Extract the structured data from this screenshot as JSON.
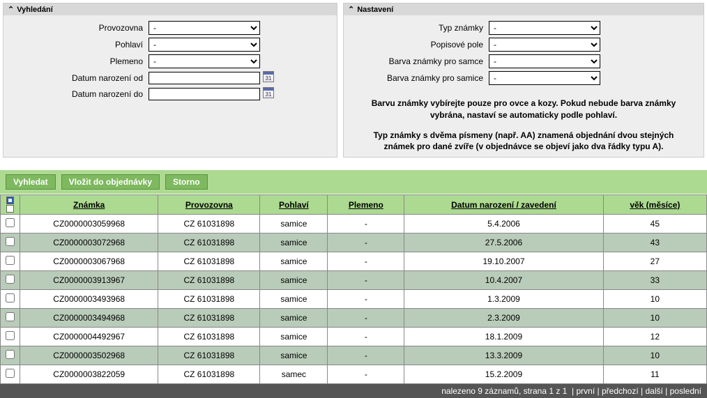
{
  "panels": {
    "search": {
      "title": "Vyhledání",
      "fields": {
        "provozovna": {
          "label": "Provozovna",
          "value": "-"
        },
        "pohlavi": {
          "label": "Pohlaví",
          "value": "-"
        },
        "plemeno": {
          "label": "Plemeno",
          "value": "-"
        },
        "datum_od": {
          "label": "Datum narození od",
          "value": ""
        },
        "datum_do": {
          "label": "Datum narození do",
          "value": ""
        }
      }
    },
    "settings": {
      "title": "Nastavení",
      "fields": {
        "typ_znamky": {
          "label": "Typ známky",
          "value": "-"
        },
        "popisove_pole": {
          "label": "Popisové pole",
          "value": "-"
        },
        "barva_samce": {
          "label": "Barva známky pro samce",
          "value": "-"
        },
        "barva_samice": {
          "label": "Barva známky pro samice",
          "value": "-"
        }
      },
      "note1": "Barvu známky vybírejte pouze pro ovce a kozy. Pokud nebude barva známky vybrána, nastaví se automaticky podle pohlaví.",
      "note2": "Typ známky s dvěma písmeny (např. AA) znamená objednání dvou stejných známek pro dané zvíře (v objednávce se objeví jako dva řádky typu A)."
    }
  },
  "buttons": {
    "vyhledat": "Vyhledat",
    "vlozit": "Vložit do objednávky",
    "storno": "Storno"
  },
  "table": {
    "headers": {
      "znamka": "Známka",
      "provozovna": "Provozovna",
      "pohlavi": "Pohlaví",
      "plemeno": "Plemeno",
      "datum": "Datum narození / zavedení",
      "vek": "věk (měsíce)"
    },
    "rows": [
      {
        "znamka": "CZ0000003059968",
        "provozovna": "CZ 61031898",
        "pohlavi": "samice",
        "plemeno": "-",
        "datum": "5.4.2006",
        "vek": "45"
      },
      {
        "znamka": "CZ0000003072968",
        "provozovna": "CZ 61031898",
        "pohlavi": "samice",
        "plemeno": "-",
        "datum": "27.5.2006",
        "vek": "43"
      },
      {
        "znamka": "CZ0000003067968",
        "provozovna": "CZ 61031898",
        "pohlavi": "samice",
        "plemeno": "-",
        "datum": "19.10.2007",
        "vek": "27"
      },
      {
        "znamka": "CZ0000003913967",
        "provozovna": "CZ 61031898",
        "pohlavi": "samice",
        "plemeno": "-",
        "datum": "10.4.2007",
        "vek": "33"
      },
      {
        "znamka": "CZ0000003493968",
        "provozovna": "CZ 61031898",
        "pohlavi": "samice",
        "plemeno": "-",
        "datum": "1.3.2009",
        "vek": "10"
      },
      {
        "znamka": "CZ0000003494968",
        "provozovna": "CZ 61031898",
        "pohlavi": "samice",
        "plemeno": "-",
        "datum": "2.3.2009",
        "vek": "10"
      },
      {
        "znamka": "CZ0000004492967",
        "provozovna": "CZ 61031898",
        "pohlavi": "samice",
        "plemeno": "-",
        "datum": "18.1.2009",
        "vek": "12"
      },
      {
        "znamka": "CZ0000003502968",
        "provozovna": "CZ 61031898",
        "pohlavi": "samice",
        "plemeno": "-",
        "datum": "13.3.2009",
        "vek": "10"
      },
      {
        "znamka": "CZ0000003822059",
        "provozovna": "CZ 61031898",
        "pohlavi": "samec",
        "plemeno": "-",
        "datum": "15.2.2009",
        "vek": "11"
      }
    ]
  },
  "pager": {
    "summary": "nalezeno 9 záznamů, strana 1 z 1",
    "first": "první",
    "prev": "předchozí",
    "next": "další",
    "last": "poslední"
  }
}
